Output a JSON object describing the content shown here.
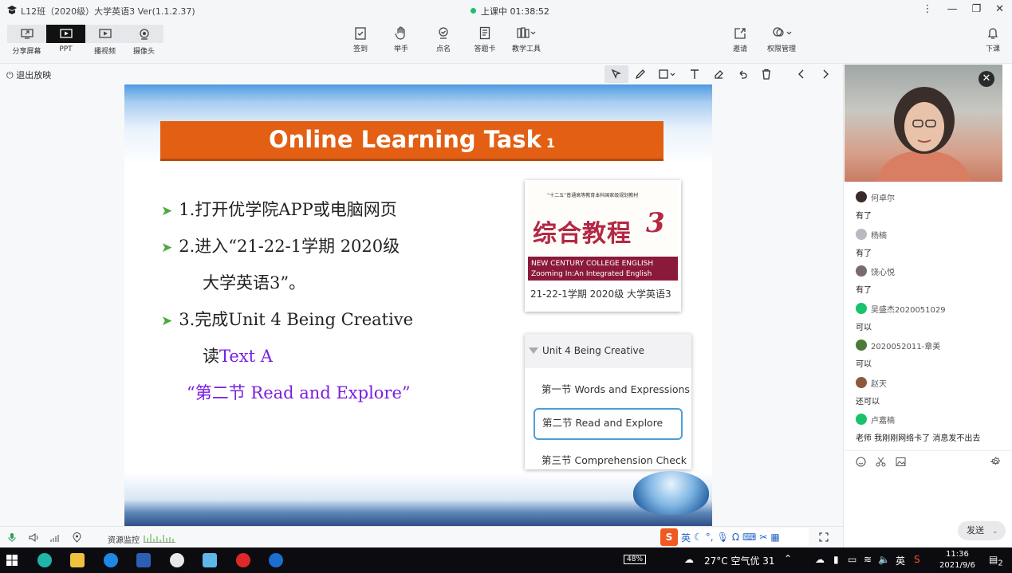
{
  "window": {
    "title": "L12班（2020级）大学英语3 Ver(1.1.2.37)",
    "live_status": "上课中 01:38:52",
    "buttons": [
      "⋮",
      "—",
      "❐",
      "✕"
    ]
  },
  "modes": [
    {
      "label": "分享屏幕",
      "icon": "share-screen-icon"
    },
    {
      "label": "PPT",
      "icon": "ppt-play-icon",
      "active": true
    },
    {
      "label": "播视频",
      "icon": "video-play-icon"
    },
    {
      "label": "摄像头",
      "icon": "camera-icon"
    }
  ],
  "tools": [
    {
      "label": "签到",
      "icon": "checkin-icon"
    },
    {
      "label": "举手",
      "icon": "hand-icon"
    },
    {
      "label": "点名",
      "icon": "rollcall-icon"
    },
    {
      "label": "答题卡",
      "icon": "answer-card-icon"
    },
    {
      "label": "教学工具",
      "icon": "teaching-tools-icon"
    },
    {
      "label": "邀请",
      "icon": "invite-icon"
    },
    {
      "label": "权限管理",
      "icon": "permission-icon"
    },
    {
      "label": "下课",
      "icon": "end-class-icon"
    }
  ],
  "subbar": {
    "exit_label": "退出放映"
  },
  "slide": {
    "banner_title": "Online Learning Task",
    "banner_num": "1",
    "bullets": {
      "b1": "1.打开优学院APP或电脑网页",
      "b2": "2.进入“21-22-1学期 2020级",
      "b2b": "大学英语3”。",
      "b3": "3.完成Unit 4 Being Creative",
      "b3b_prefix": "读",
      "b3b_purple": "Text A",
      "b4": "“第二节 Read and Explore”"
    },
    "book": {
      "top_text": "“十二五”普通高等教育本科国家级规划教材",
      "title_cn": "综合教程",
      "number": "3",
      "band_line1": "NEW CENTURY COLLEGE ENGLISH",
      "band_line2": "Zooming In:An Integrated English Course",
      "caption": "21-22-1学期 2020级 大学英语3"
    },
    "unit": {
      "header": "Unit 4 Being Creative",
      "items": [
        "第一节 Words and Expressions",
        "第二节 Read and Explore",
        "第三节 Comprehension Check"
      ]
    }
  },
  "chat": [
    {
      "name": "何卓尔",
      "text": "有了",
      "color": "#3a2a2a"
    },
    {
      "name": "杨楠",
      "text": "有了",
      "color": "#b9b9c2"
    },
    {
      "name": "饶心悦",
      "text": "有了",
      "color": "#7a6a70"
    },
    {
      "name": "吴盛杰2020051029",
      "text": "可以",
      "color": "#19c26b"
    },
    {
      "name": "2020052011-章美",
      "text": "可以",
      "color": "#4a7a3a"
    },
    {
      "name": "赵天",
      "text": "还可以",
      "color": "#8a5a3a"
    },
    {
      "name": "卢嘉楠",
      "text": "老师 我刚刚网络卡了 消息发不出去",
      "color": "#19c26b"
    }
  ],
  "send_label": "发送",
  "status": {
    "resource_label": "资源监控"
  },
  "ime": {
    "lang": "英"
  },
  "taskbar": {
    "battery": "48%",
    "weather": "27°C 空气优 31",
    "lang": "英",
    "time": "11:36",
    "date": "2021/9/6",
    "notif_count": "2"
  }
}
